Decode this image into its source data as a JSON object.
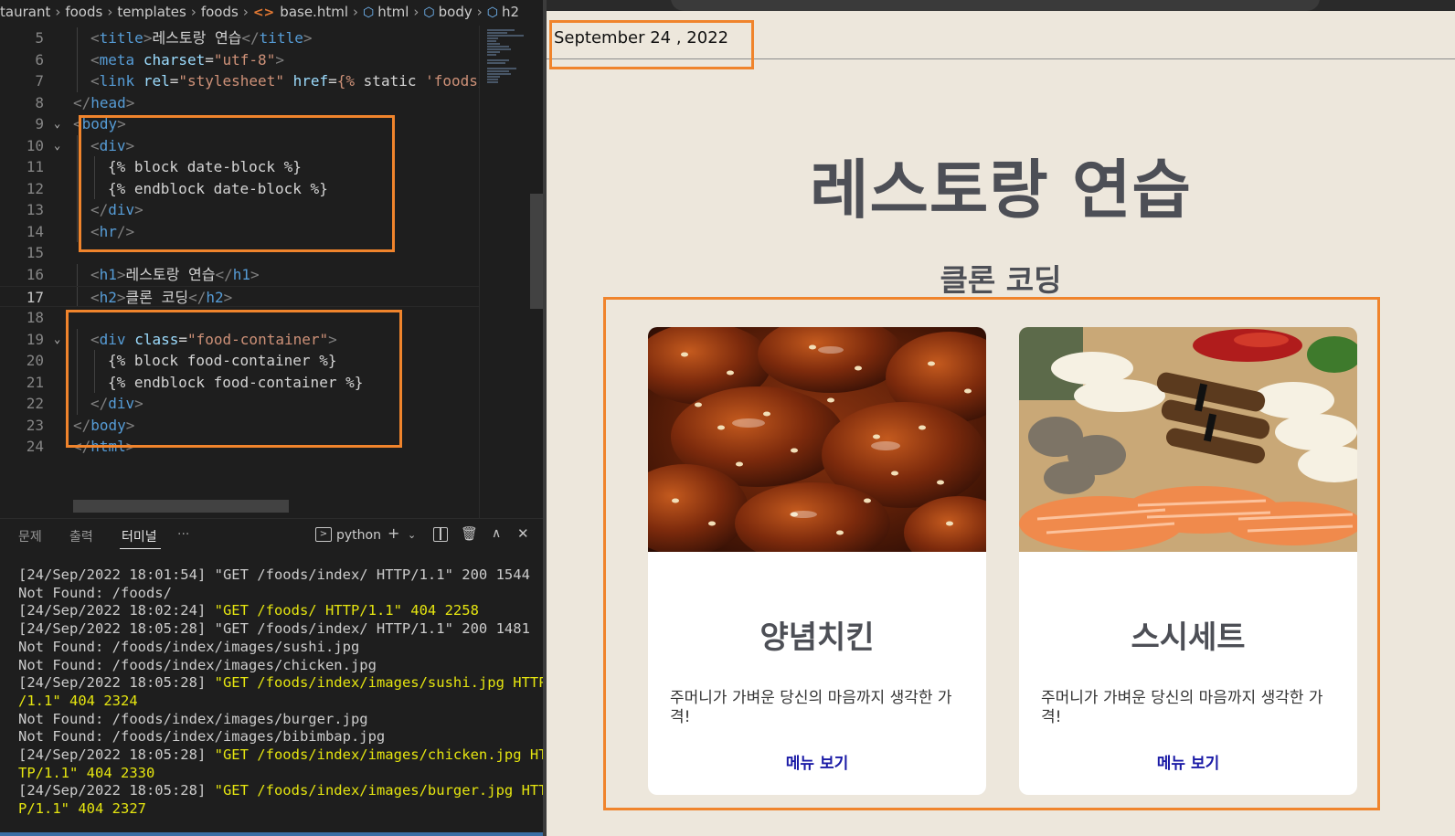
{
  "editor": {
    "breadcrumb": [
      "taurant",
      "foods",
      "templates",
      "foods",
      "base.html",
      "html",
      "body",
      "h2"
    ],
    "lines": [
      {
        "n": "5",
        "html": "<span class='t-punc'>&lt;</span><span class='t-tag'>title</span><span class='t-punc'>&gt;</span><span class='t-text'>레스토랑 연습</span><span class='t-punc'>&lt;/</span><span class='t-tag'>title</span><span class='t-punc'>&gt;</span>",
        "indent": 1
      },
      {
        "n": "6",
        "html": "<span class='t-punc'>&lt;</span><span class='t-tag'>meta</span> <span class='t-attr'>charset</span><span class='t-text'>=</span><span class='t-str'>\"utf-8\"</span><span class='t-punc'>&gt;</span>",
        "indent": 1
      },
      {
        "n": "7",
        "html": "<span class='t-punc'>&lt;</span><span class='t-tag'>link</span> <span class='t-attr'>rel</span><span class='t-text'>=</span><span class='t-str'>\"stylesheet\"</span> <span class='t-attr'>href</span><span class='t-text'>=</span><span class='t-str'>{%</span> <span class='t-tpl'>static</span> <span class='t-str'>'foods/</span>",
        "indent": 1
      },
      {
        "n": "8",
        "html": "<span class='t-punc'>&lt;/</span><span class='t-tag'>head</span><span class='t-punc'>&gt;</span>",
        "indent": 0
      },
      {
        "n": "9",
        "html": "<span class='t-punc'>&lt;</span><span class='t-tag'>body</span><span class='t-punc'>&gt;</span>",
        "indent": 0,
        "fold": true
      },
      {
        "n": "10",
        "html": "<span class='t-punc'>&lt;</span><span class='t-tag'>div</span><span class='t-punc'>&gt;</span>",
        "indent": 1,
        "fold": true
      },
      {
        "n": "11",
        "html": "<span class='t-tpl'>{% block date-block %}</span>",
        "indent": 2
      },
      {
        "n": "12",
        "html": "<span class='t-tpl'>{% endblock date-block %}</span>",
        "indent": 2
      },
      {
        "n": "13",
        "html": "<span class='t-punc'>&lt;/</span><span class='t-tag'>div</span><span class='t-punc'>&gt;</span>",
        "indent": 1
      },
      {
        "n": "14",
        "html": "<span class='t-punc'>&lt;</span><span class='t-tag'>hr</span><span class='t-punc'>/&gt;</span>",
        "indent": 1
      },
      {
        "n": "15",
        "html": "",
        "indent": 0
      },
      {
        "n": "16",
        "html": "<span class='t-punc'>&lt;</span><span class='t-tag'>h1</span><span class='t-punc'>&gt;</span><span class='t-text'>레스토랑 연습</span><span class='t-punc'>&lt;/</span><span class='t-tag'>h1</span><span class='t-punc'>&gt;</span>",
        "indent": 1
      },
      {
        "n": "17",
        "html": "<span class='t-punc'>&lt;</span><span class='t-tag'>h2</span><span class='t-punc'>&gt;</span><span class='t-text'>클론 코딩</span><span class='t-punc'>&lt;/</span><span class='t-tag'>h2</span><span class='t-punc'>&gt;</span>",
        "indent": 1,
        "current": true
      },
      {
        "n": "18",
        "html": "",
        "indent": 0
      },
      {
        "n": "19",
        "html": "<span class='t-punc'>&lt;</span><span class='t-tag'>div</span> <span class='t-attr'>class</span><span class='t-text'>=</span><span class='t-str'>\"food-container\"</span><span class='t-punc'>&gt;</span>",
        "indent": 1,
        "fold": true
      },
      {
        "n": "20",
        "html": "<span class='t-tpl'>{% block food-container %}</span>",
        "indent": 2
      },
      {
        "n": "21",
        "html": "<span class='t-tpl'>{% endblock food-container %}</span>",
        "indent": 2
      },
      {
        "n": "22",
        "html": "<span class='t-punc'>&lt;/</span><span class='t-tag'>div</span><span class='t-punc'>&gt;</span>",
        "indent": 1
      },
      {
        "n": "23",
        "html": "<span class='t-punc'>&lt;/</span><span class='t-tag'>body</span><span class='t-punc'>&gt;</span>",
        "indent": 0
      },
      {
        "n": "24",
        "html": "<span class='t-punc'>&lt;/</span><span class='t-tag'>html</span><span class='t-punc'>&gt;</span>",
        "indent": 0
      }
    ]
  },
  "panel": {
    "tabs": [
      "문제",
      "출력",
      "터미널",
      "···"
    ],
    "active_tab": "터미널",
    "shell": "python",
    "terminal": [
      {
        "text": "[24/Sep/2022 18:01:54] \"GET /foods/index/ HTTP/1.1\" 200 1544"
      },
      {
        "text": "Not Found: /foods/"
      },
      {
        "text": "[24/Sep/2022 18:02:24] ",
        "warn": "\"GET /foods/ HTTP/1.1\" 404 2258"
      },
      {
        "text": "[24/Sep/2022 18:05:28] \"GET /foods/index/ HTTP/1.1\" 200 1481"
      },
      {
        "text": "Not Found: /foods/index/images/sushi.jpg"
      },
      {
        "text": "Not Found: /foods/index/images/chicken.jpg"
      },
      {
        "text": "[24/Sep/2022 18:05:28] ",
        "warn": "\"GET /foods/index/images/sushi.jpg HTTP"
      },
      {
        "text": "",
        "warn": "/1.1\" 404 2324"
      },
      {
        "text": "Not Found: /foods/index/images/burger.jpg"
      },
      {
        "text": "Not Found: /foods/index/images/bibimbap.jpg"
      },
      {
        "text": "[24/Sep/2022 18:05:28] ",
        "warn": "\"GET /foods/index/images/chicken.jpg HT"
      },
      {
        "text": "",
        "warn": "TP/1.1\" 404 2330"
      },
      {
        "text": "[24/Sep/2022 18:05:28] ",
        "warn": "\"GET /foods/index/images/burger.jpg HTT"
      },
      {
        "text": "",
        "warn": "P/1.1\" 404 2327"
      }
    ]
  },
  "page": {
    "date": "September 24 , 2022",
    "title": "레스토랑 연습",
    "subtitle": "클론 코딩",
    "foods": [
      {
        "name": "양념치킨",
        "desc": "주머니가 가벼운 당신의 마음까지 생각한 가격!",
        "link": "메뉴 보기",
        "image": "fried-chicken-photo"
      },
      {
        "name": "스시세트",
        "desc": "주머니가 가벼운 당신의 마음까지 생각한 가격!",
        "link": "메뉴 보기",
        "image": "sushi-platter-photo"
      }
    ]
  },
  "colors": {
    "highlight": "#f0842c",
    "page_bg": "#ede7dc",
    "title": "#4d4f56",
    "link": "#1a1aa6"
  }
}
